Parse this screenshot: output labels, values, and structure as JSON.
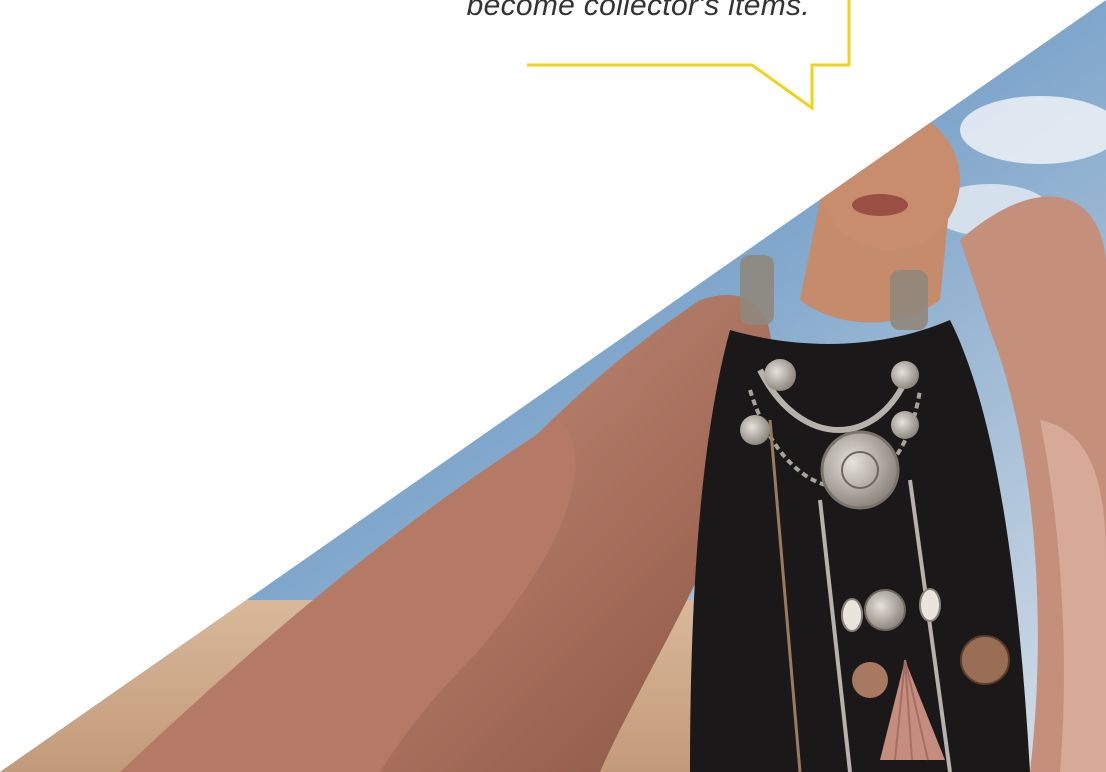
{
  "quote": {
    "text": "become collector's items."
  },
  "colors": {
    "accent_yellow": "#f2d31a",
    "text_dark": "#333333",
    "background": "#ffffff",
    "sky": "#8fb4d6",
    "fabric": "#b98270",
    "fabric_dark": "#7b4c3e",
    "top_black": "#1a1818",
    "skin": "#c58c6c",
    "silver": "#b7b2ab"
  },
  "hero_image": {
    "subject": "model-wearing-silver-tribal-jewelry"
  }
}
